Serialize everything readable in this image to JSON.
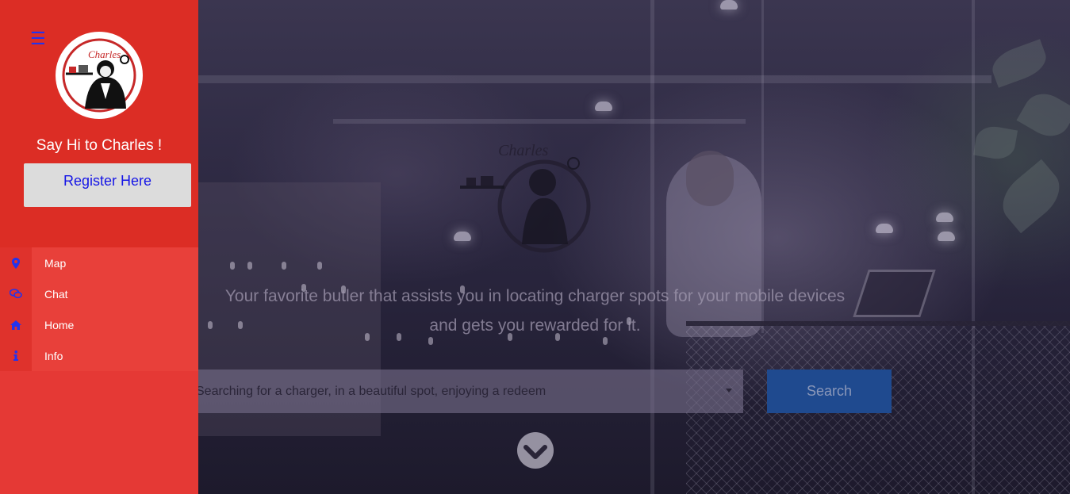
{
  "sidebar": {
    "menu_toggle_glyph": "☰",
    "brand_logo_text": "Charles",
    "greeting": "Say Hi to Charles !",
    "register_label": "Register Here",
    "items": [
      {
        "label": "Map",
        "icon": "map-marker-icon"
      },
      {
        "label": "Chat",
        "icon": "chat-bubbles-icon"
      },
      {
        "label": "Home",
        "icon": "home-icon"
      },
      {
        "label": "Info",
        "icon": "info-icon"
      }
    ]
  },
  "hero": {
    "logo_text": "Charles",
    "tagline_line1": "Your favorite butler that assists you in locating charger spots for your mobile devices",
    "tagline_line2": "and gets you rewarded for it.",
    "search": {
      "selected_value": "Searching for a charger, in a beautiful spot, enjoying a redeem",
      "button_label": "Search"
    },
    "scroll_icon": "chevron-down-circle-icon"
  },
  "colors": {
    "sidebar": "#e53935",
    "sidebar_top": "#dc2d25",
    "register_text": "#1515e6",
    "icon_blue": "#2233ee",
    "search_button": "#1f4a8f"
  }
}
